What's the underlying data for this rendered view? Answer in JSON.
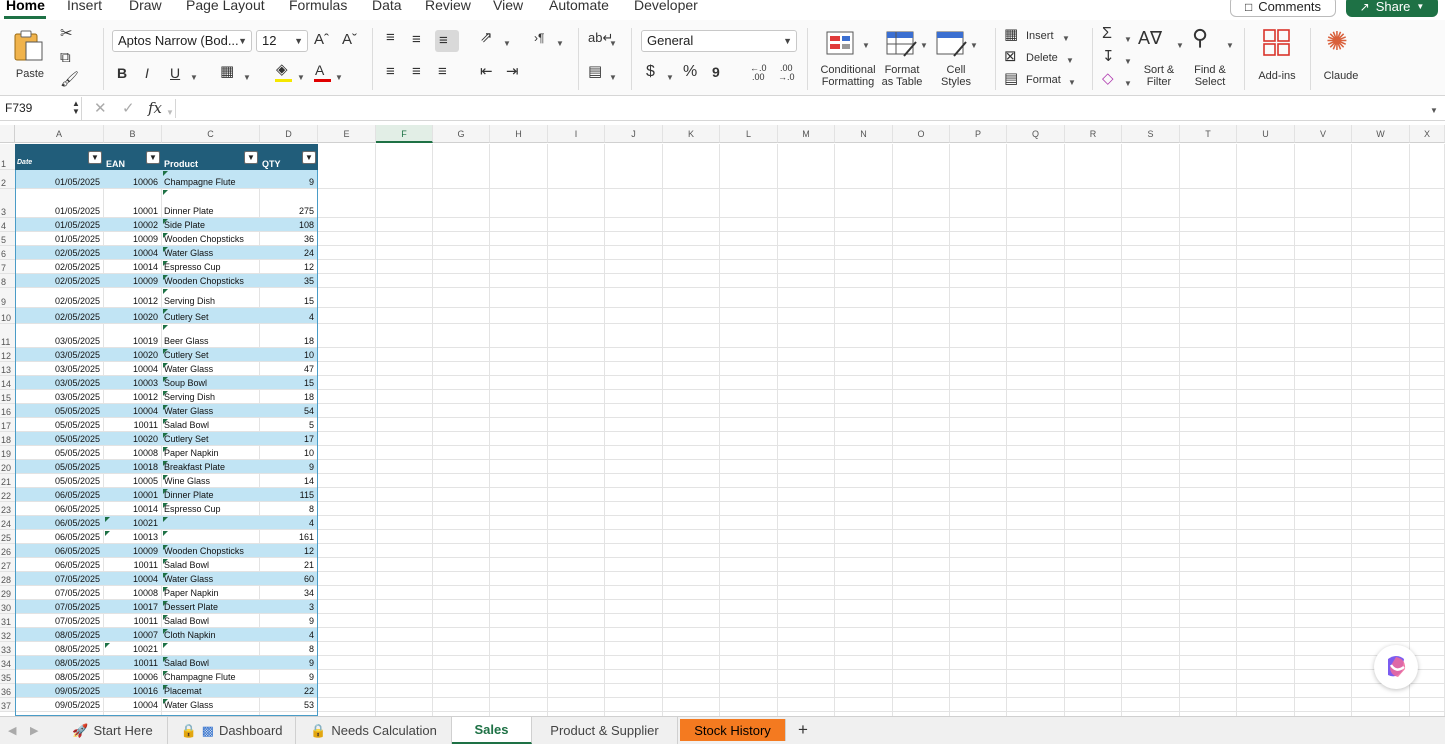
{
  "menu": {
    "tabs": [
      "Home",
      "Insert",
      "Draw",
      "Page Layout",
      "Formulas",
      "Data",
      "Review",
      "View",
      "Automate",
      "Developer"
    ],
    "active": "Home",
    "comments_label": "Comments",
    "share_label": "Share"
  },
  "ribbon": {
    "paste_label": "Paste",
    "font_name": "Aptos Narrow (Bod...",
    "font_size": "12",
    "bold": "B",
    "italic": "I",
    "underline": "U",
    "number_format": "General",
    "currency": "$",
    "percent": "%",
    "comma": "9",
    "increase_decimal": "←.0\n.00",
    "decrease_decimal": ".00\n→.0",
    "conditional_formatting_label": "Conditional Formatting",
    "format_as_table_label": "Format as Table",
    "cell_styles_label": "Cell Styles",
    "insert_label": "Insert",
    "delete_label": "Delete",
    "format_label": "Format",
    "sort_filter_label": "Sort & Filter",
    "find_select_label": "Find & Select",
    "addins_label": "Add-ins",
    "claude_label": "Claude",
    "accent_color": "#1e7145"
  },
  "formula_bar": {
    "name_box": "F739",
    "fx_symbol": "fx",
    "formula": ""
  },
  "grid": {
    "columns": [
      "A",
      "B",
      "C",
      "D",
      "E",
      "F",
      "G",
      "H",
      "I",
      "J",
      "K",
      "L",
      "M",
      "N",
      "O",
      "P",
      "Q",
      "R",
      "S",
      "T",
      "U",
      "V",
      "W",
      "X"
    ],
    "selected_column": "F",
    "table_headers": [
      "Date",
      "EAN",
      "Product",
      "QTY"
    ],
    "band_color": "#c1e4f4",
    "header_color": "#215d7a",
    "rows": [
      {
        "n": "2",
        "date": "01/05/2025",
        "ean": "10006",
        "product": "Champagne Flute",
        "qty": "9"
      },
      {
        "n": "3",
        "date": "01/05/2025",
        "ean": "10001",
        "product": "Dinner Plate",
        "qty": "275"
      },
      {
        "n": "4",
        "date": "01/05/2025",
        "ean": "10002",
        "product": "Side Plate",
        "qty": "108"
      },
      {
        "n": "5",
        "date": "01/05/2025",
        "ean": "10009",
        "product": "Wooden Chopsticks",
        "qty": "36"
      },
      {
        "n": "6",
        "date": "02/05/2025",
        "ean": "10004",
        "product": "Water Glass",
        "qty": "24"
      },
      {
        "n": "7",
        "date": "02/05/2025",
        "ean": "10014",
        "product": "Espresso Cup",
        "qty": "12"
      },
      {
        "n": "8",
        "date": "02/05/2025",
        "ean": "10009",
        "product": "Wooden Chopsticks",
        "qty": "35"
      },
      {
        "n": "9",
        "date": "02/05/2025",
        "ean": "10012",
        "product": "Serving Dish",
        "qty": "15"
      },
      {
        "n": "10",
        "date": "02/05/2025",
        "ean": "10020",
        "product": "Cutlery Set",
        "qty": "4"
      },
      {
        "n": "11",
        "date": "03/05/2025",
        "ean": "10019",
        "product": "Beer Glass",
        "qty": "18"
      },
      {
        "n": "12",
        "date": "03/05/2025",
        "ean": "10020",
        "product": "Cutlery Set",
        "qty": "10"
      },
      {
        "n": "13",
        "date": "03/05/2025",
        "ean": "10004",
        "product": "Water Glass",
        "qty": "47"
      },
      {
        "n": "14",
        "date": "03/05/2025",
        "ean": "10003",
        "product": "Soup Bowl",
        "qty": "15"
      },
      {
        "n": "15",
        "date": "03/05/2025",
        "ean": "10012",
        "product": "Serving Dish",
        "qty": "18"
      },
      {
        "n": "16",
        "date": "05/05/2025",
        "ean": "10004",
        "product": "Water Glass",
        "qty": "54"
      },
      {
        "n": "17",
        "date": "05/05/2025",
        "ean": "10011",
        "product": "Salad Bowl",
        "qty": "5"
      },
      {
        "n": "18",
        "date": "05/05/2025",
        "ean": "10020",
        "product": "Cutlery Set",
        "qty": "17"
      },
      {
        "n": "19",
        "date": "05/05/2025",
        "ean": "10008",
        "product": "Paper Napkin",
        "qty": "10"
      },
      {
        "n": "20",
        "date": "05/05/2025",
        "ean": "10018",
        "product": "Breakfast Plate",
        "qty": "9"
      },
      {
        "n": "21",
        "date": "05/05/2025",
        "ean": "10005",
        "product": "Wine Glass",
        "qty": "14"
      },
      {
        "n": "22",
        "date": "06/05/2025",
        "ean": "10001",
        "product": "Dinner Plate",
        "qty": "115"
      },
      {
        "n": "23",
        "date": "06/05/2025",
        "ean": "10014",
        "product": "Espresso Cup",
        "qty": "8"
      },
      {
        "n": "24",
        "date": "06/05/2025",
        "ean": "10021",
        "product": "",
        "qty": "4"
      },
      {
        "n": "25",
        "date": "06/05/2025",
        "ean": "10013",
        "product": "",
        "qty": "161"
      },
      {
        "n": "26",
        "date": "06/05/2025",
        "ean": "10009",
        "product": "Wooden Chopsticks",
        "qty": "12"
      },
      {
        "n": "27",
        "date": "06/05/2025",
        "ean": "10011",
        "product": "Salad Bowl",
        "qty": "21"
      },
      {
        "n": "28",
        "date": "07/05/2025",
        "ean": "10004",
        "product": "Water Glass",
        "qty": "60"
      },
      {
        "n": "29",
        "date": "07/05/2025",
        "ean": "10008",
        "product": "Paper Napkin",
        "qty": "34"
      },
      {
        "n": "30",
        "date": "07/05/2025",
        "ean": "10017",
        "product": "Dessert Plate",
        "qty": "3"
      },
      {
        "n": "31",
        "date": "07/05/2025",
        "ean": "10011",
        "product": "Salad Bowl",
        "qty": "9"
      },
      {
        "n": "32",
        "date": "08/05/2025",
        "ean": "10007",
        "product": "Cloth Napkin",
        "qty": "4"
      },
      {
        "n": "33",
        "date": "08/05/2025",
        "ean": "10021",
        "product": "",
        "qty": "8"
      },
      {
        "n": "34",
        "date": "08/05/2025",
        "ean": "10011",
        "product": "Salad Bowl",
        "qty": "9"
      },
      {
        "n": "35",
        "date": "08/05/2025",
        "ean": "10006",
        "product": "Champagne Flute",
        "qty": "9"
      },
      {
        "n": "36",
        "date": "09/05/2025",
        "ean": "10016",
        "product": "Placemat",
        "qty": "22"
      },
      {
        "n": "37",
        "date": "09/05/2025",
        "ean": "10004",
        "product": "Water Glass",
        "qty": "53"
      }
    ]
  },
  "sheet_tabs": [
    {
      "label": "Start Here",
      "icon": "rocket-icon"
    },
    {
      "label": "Dashboard",
      "icon": "lock-chart-icon"
    },
    {
      "label": "Needs Calculation",
      "icon": "lock-icon"
    },
    {
      "label": "Sales",
      "icon": ""
    },
    {
      "label": "Product & Supplier",
      "icon": ""
    },
    {
      "label": "Stock History",
      "icon": ""
    }
  ],
  "active_sheet": "Sales",
  "highlight_tab_color": "#f47a20",
  "add_sheet_symbol": "+"
}
